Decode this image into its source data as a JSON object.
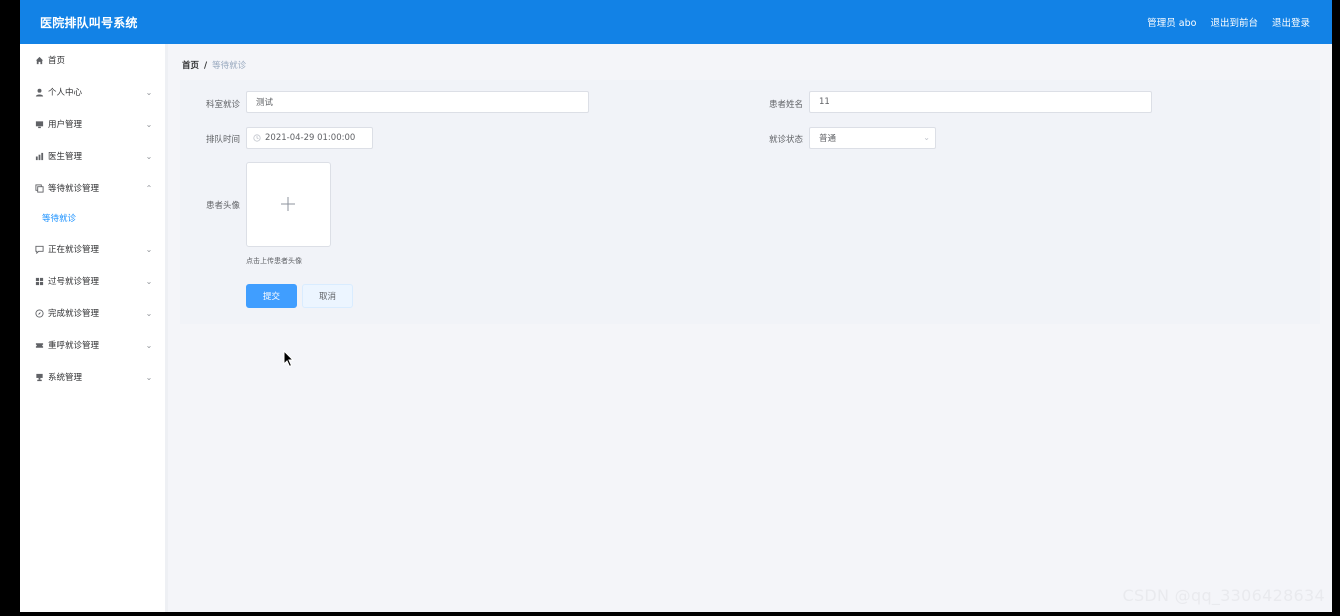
{
  "app": {
    "title": "医院排队叫号系统"
  },
  "header": {
    "admin": "管理员 abo",
    "to_front": "退出到前台",
    "logout": "退出登录"
  },
  "sidebar": {
    "items": [
      {
        "label": "首页",
        "icon": "home-icon"
      },
      {
        "label": "个人中心",
        "icon": "user-icon"
      },
      {
        "label": "用户管理",
        "icon": "monitor-icon"
      },
      {
        "label": "医生管理",
        "icon": "chart-icon"
      },
      {
        "label": "等待就诊管理",
        "icon": "copy-icon"
      },
      {
        "label": "正在就诊管理",
        "icon": "message-icon"
      },
      {
        "label": "过号就诊管理",
        "icon": "grid-icon"
      },
      {
        "label": "完成就诊管理",
        "icon": "compass-icon"
      },
      {
        "label": "重呼就诊管理",
        "icon": "ticket-icon"
      },
      {
        "label": "系统管理",
        "icon": "screen-icon"
      }
    ],
    "active_sub": "等待就诊"
  },
  "breadcrumb": {
    "home": "首页",
    "sep": "/",
    "current": "等待就诊"
  },
  "form": {
    "dept_label": "科室就诊",
    "dept_value": "测试",
    "patient_label": "患者姓名",
    "patient_value": "11",
    "time_label": "排队时间",
    "time_value": "2021-04-29 01:00:00",
    "status_label": "就诊状态",
    "status_value": "普通",
    "avatar_label": "患者头像",
    "upload_tip": "点击上传患者头像",
    "submit": "提交",
    "cancel": "取消"
  },
  "watermark": "CSDN @qq_3306428634",
  "colors": {
    "header": "#1282e6",
    "primary": "#409eff",
    "active": "#1890ff"
  }
}
